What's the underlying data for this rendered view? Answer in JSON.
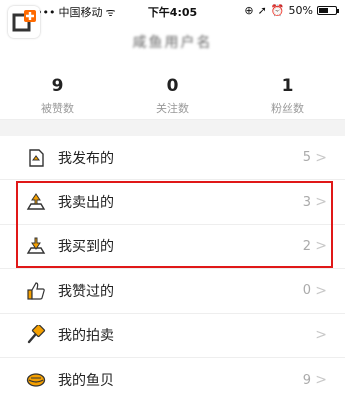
{
  "status_bar": {
    "carrier": "中国移动",
    "time": "下午4:05",
    "battery_percent": "50%",
    "battery_level": 0.5
  },
  "header": {
    "nickname": "咸鱼用户名"
  },
  "stats": [
    {
      "value": "9",
      "label": "被赞数"
    },
    {
      "value": "0",
      "label": "关注数"
    },
    {
      "value": "1",
      "label": "粉丝数"
    }
  ],
  "menu": [
    {
      "label": "我发布的",
      "count": "5",
      "icon": "post-icon"
    },
    {
      "label": "我卖出的",
      "count": "3",
      "icon": "sell-icon"
    },
    {
      "label": "我买到的",
      "count": "2",
      "icon": "buy-icon"
    },
    {
      "label": "我赞过的",
      "count": "0",
      "icon": "thumbs-up-icon"
    },
    {
      "label": "我的拍卖",
      "count": "",
      "icon": "auction-hammer-icon"
    },
    {
      "label": "我的鱼贝",
      "count": "9",
      "icon": "shell-icon"
    }
  ],
  "colors": {
    "accent": "#f5a000",
    "highlight_border": "#e01818"
  }
}
